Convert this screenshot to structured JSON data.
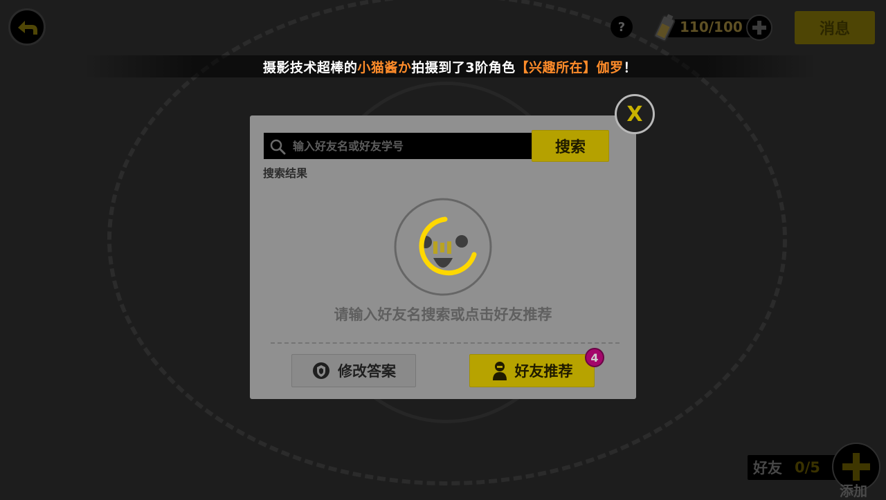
{
  "header": {
    "help_label": "?",
    "energy_text": "110/100",
    "message_label": "消息"
  },
  "marquee": {
    "part1": "摄影技术超棒的",
    "user_name": "小猫酱か",
    "part2": "拍摄到了3阶角色",
    "character": "【兴趣所在】伽罗",
    "part3": "！"
  },
  "dialog": {
    "close_label": "X",
    "search": {
      "placeholder": "输入好友名或好友学号",
      "button_label": "搜索"
    },
    "result_label": "搜索结果",
    "empty_text": "请输入好友名搜索或点击好友推荐",
    "edit_answer_label": "修改答案",
    "recommend_label": "好友推荐",
    "recommend_badge": "4"
  },
  "friends": {
    "label": "好友",
    "count": "0/5",
    "add_label": "添加"
  },
  "colors": {
    "accent_yellow": "#b7a300",
    "highlight_orange": "#ff8c2a",
    "badge_magenta": "#a4066b"
  }
}
